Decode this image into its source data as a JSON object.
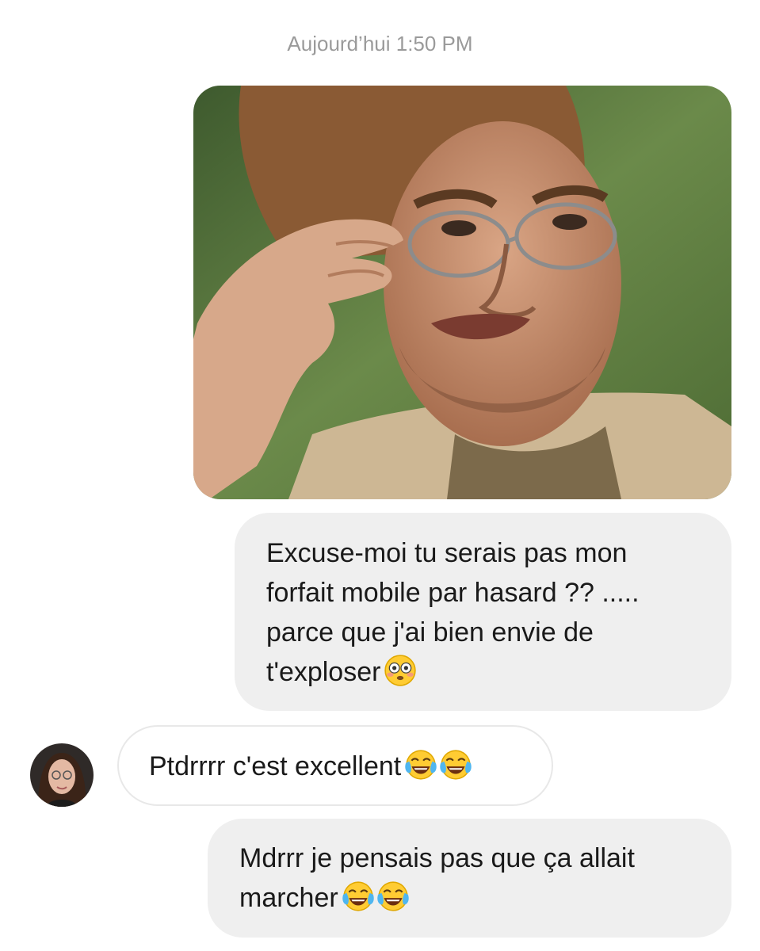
{
  "conversation": {
    "timestamp": "Aujourd’hui 1:50 PM",
    "shared_image": {
      "icon": "photo-man-adjusting-glasses"
    },
    "messages": [
      {
        "sender": "me",
        "lines": [
          "Excuse-moi tu serais pas mon",
          "forfait mobile par hasard ?? .....",
          "parce que j'ai bien envie de",
          "t'exploser"
        ],
        "emoji": [
          "flushed-face"
        ]
      },
      {
        "sender": "contact",
        "avatar_icon": "contact-avatar",
        "lines": [
          "Ptdrrrr c'est excellent"
        ],
        "emoji": [
          "tears-of-joy",
          "tears-of-joy"
        ]
      },
      {
        "sender": "me",
        "lines": [
          "Mdrrr je pensais pas que ça allait",
          "marcher"
        ],
        "emoji": [
          "tears-of-joy",
          "tears-of-joy"
        ]
      }
    ]
  },
  "colors": {
    "background": "#ffffff",
    "outgoing_bubble": "#efefef",
    "incoming_bubble_border": "#e8e8e8",
    "timestamp_text": "#9a9a9a",
    "message_text": "#1a1a1a"
  }
}
